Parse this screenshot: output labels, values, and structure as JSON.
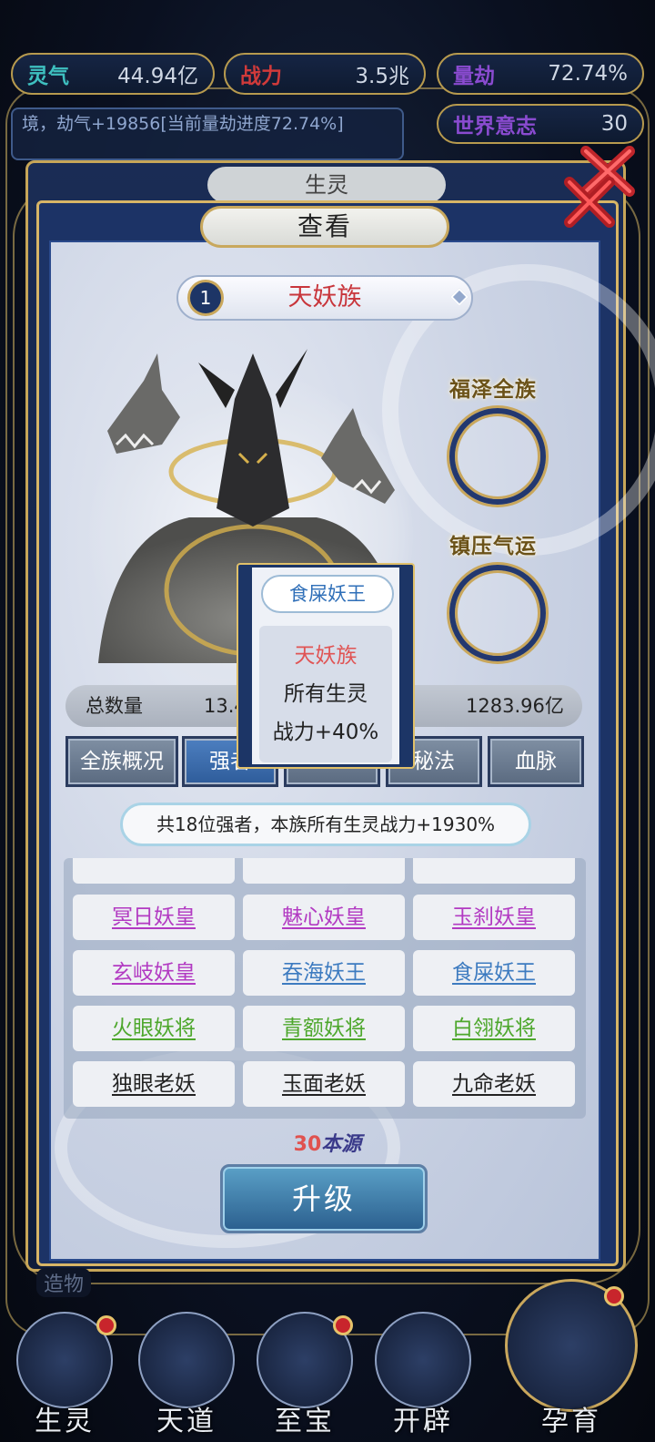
{
  "top_stats": [
    {
      "key": "灵气",
      "value": "44.94亿",
      "key_color": "#3ec0c0"
    },
    {
      "key": "战力",
      "value": "3.5兆",
      "key_color": "#d03a3a"
    },
    {
      "key": "量劫",
      "value": "72.74%",
      "key_color": "#8a4bd0"
    }
  ],
  "log_text": "境，劫气+19856[当前量劫进度72.74%]",
  "world_will": {
    "key": "世界意志",
    "value": "30"
  },
  "back_panel_title": "生灵",
  "panel_title": "查看",
  "race": {
    "rank": "1",
    "name": "天妖族"
  },
  "side_slots": [
    {
      "label": "福泽全族"
    },
    {
      "label": "镇压气运"
    }
  ],
  "totals": {
    "label": "总数量",
    "value_left": "13.4",
    "value_right": "1283.96亿"
  },
  "tabs": [
    {
      "label": "全族概况",
      "active": false
    },
    {
      "label": "强者",
      "active": true
    },
    {
      "label": "",
      "active": false
    },
    {
      "label": "秘法",
      "active": false
    },
    {
      "label": "血脉",
      "active": false
    }
  ],
  "banner": "共18位强者，本族所有生灵战力+1930%",
  "grid": [
    [
      {
        "name": "",
        "color": "orange"
      },
      {
        "name": "",
        "color": "orange"
      },
      {
        "name": "",
        "color": "orange"
      }
    ],
    [
      {
        "name": "冥日妖皇",
        "color": "purple"
      },
      {
        "name": "魅心妖皇",
        "color": "purple"
      },
      {
        "name": "玉刹妖皇",
        "color": "purple"
      }
    ],
    [
      {
        "name": "玄岐妖皇",
        "color": "purple"
      },
      {
        "name": "吞海妖王",
        "color": "blue"
      },
      {
        "name": "食屎妖王",
        "color": "blue"
      }
    ],
    [
      {
        "name": "火眼妖将",
        "color": "green"
      },
      {
        "name": "青额妖将",
        "color": "green"
      },
      {
        "name": "白翎妖将",
        "color": "green"
      }
    ],
    [
      {
        "name": "独眼老妖",
        "color": "black"
      },
      {
        "name": "玉面老妖",
        "color": "black"
      },
      {
        "name": "九命老妖",
        "color": "black"
      }
    ]
  ],
  "cost": {
    "amount": "30",
    "unit": "本源"
  },
  "upgrade_label": "升级",
  "popup": {
    "title": "食屎妖王",
    "race": "天妖族",
    "line1": "所有生灵",
    "line2": "战力+40%"
  },
  "bottom_small_label": "造物",
  "nav": [
    {
      "label": "生灵",
      "dot": true
    },
    {
      "label": "天道",
      "dot": false
    },
    {
      "label": "至宝",
      "dot": true
    },
    {
      "label": "开辟",
      "dot": false
    },
    {
      "label": "孕育",
      "dot": true
    }
  ]
}
